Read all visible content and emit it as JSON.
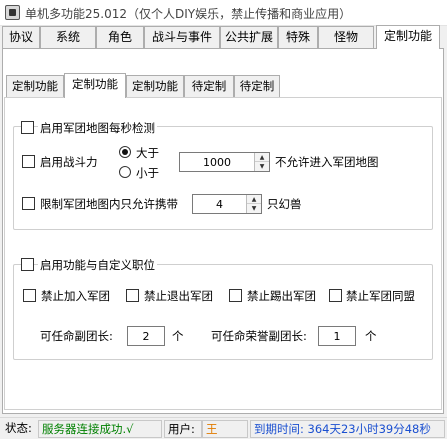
{
  "window": {
    "title": "单机多功能25.012（仅个人DIY娱乐，禁止传播和商业应用）"
  },
  "top_tabs": [
    {
      "label": "协议"
    },
    {
      "label": "系统"
    },
    {
      "label": "角色"
    },
    {
      "label": "战斗与事件"
    },
    {
      "label": "公共扩展"
    },
    {
      "label": "特殊"
    },
    {
      "label": "怪物"
    },
    {
      "label": "定制功能",
      "active": true
    }
  ],
  "sub_tabs": [
    {
      "label": "定制功能"
    },
    {
      "label": "定制功能",
      "active": true
    },
    {
      "label": "定制功能"
    },
    {
      "label": "待定制"
    },
    {
      "label": "待定制"
    }
  ],
  "group1": {
    "title": "启用军团地图每秒检测",
    "power_check_label": "启用战斗力",
    "radio_greater": "大于",
    "radio_less": "小于",
    "power_value": "1000",
    "power_suffix": "不允许进入军团地图",
    "limit_label": "限制军团地图内只允许携带",
    "limit_value": "4",
    "limit_suffix": "只幻兽"
  },
  "group2": {
    "title": "启用功能与自定义职位",
    "cb_join": "禁止加入军团",
    "cb_leave": "禁止退出军团",
    "cb_kick": "禁止踢出军团",
    "cb_alliance": "禁止军团同盟",
    "vice_label": "可任命副团长:",
    "vice_value": "2",
    "vice_unit": "个",
    "honor_label": "可任命荣誉副团长:",
    "honor_value": "1",
    "honor_unit": "个"
  },
  "status": {
    "label": "状态:",
    "server_text": "服务器连接成功.√",
    "user_label": "用户:",
    "user_name": "王",
    "expire_text": "到期时间: 364天23小时39分48秒"
  },
  "colors": {
    "server_ok": "#008000",
    "user_name": "#e07a00",
    "expire": "#1a4fd0"
  }
}
